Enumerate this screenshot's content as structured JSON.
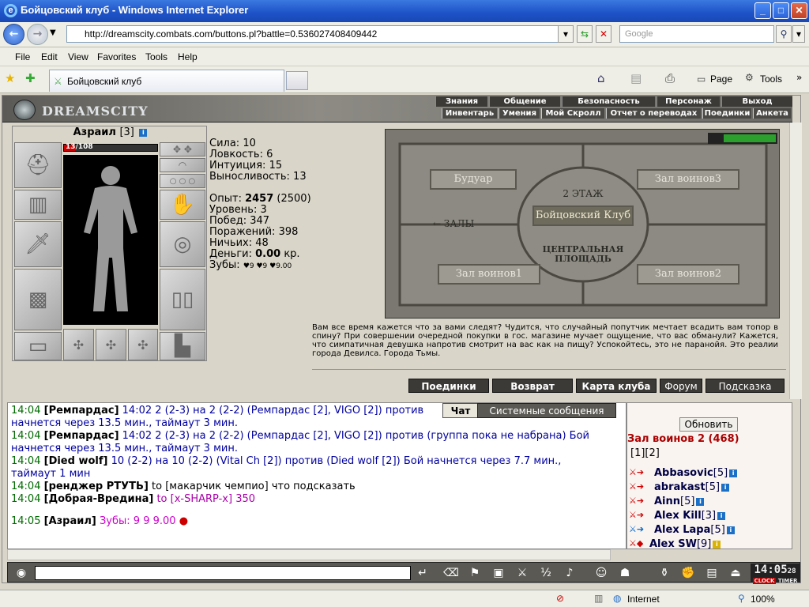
{
  "window": {
    "title": "Бойцовский клуб - Windows Internet Explorer",
    "min": "_",
    "max": "□",
    "close": "✕"
  },
  "address": {
    "url": "http://dreamscity.combats.com/buttons.pl?battle=0.536027408409442",
    "search_placeholder": "Google"
  },
  "menu": [
    "File",
    "Edit",
    "View",
    "Favorites",
    "Tools",
    "Help"
  ],
  "tab": {
    "label": "Бойцовский клуб"
  },
  "toolbar": {
    "page": "Page",
    "tools": "Tools"
  },
  "game": {
    "logo": "DREAMSCITY",
    "topnav": [
      "Знания",
      "Общение",
      "Безопасность",
      "Персонаж",
      "Выход"
    ],
    "subnav": [
      "Инвентарь",
      "Умения",
      "Мой Скролл",
      "Отчет о переводах",
      "Поединки",
      "Анкета"
    ]
  },
  "character": {
    "name": "Азраил",
    "level": "[3]",
    "hp": {
      "current": 13,
      "max": 108,
      "text_cur": "13",
      "text_max": "/108"
    },
    "stats": {
      "strength": "Сила: 10",
      "agility": "Ловкость: 6",
      "intuition": "Интуиция: 15",
      "endurance": "Выносливость: 13",
      "exp_label": "Опыт: ",
      "exp_value": "2457",
      "exp_next": " (2500)",
      "level": "Уровень: 3",
      "wins": "Побед: 347",
      "losses": "Поражений: 398",
      "draws": "Ничьих: 48",
      "money_label": "Деньги: ",
      "money_value": "0.00",
      "money_unit": " кр.",
      "teeth_label": "Зубы: ",
      "teeth_value": "♥9 ♥9 ♥9.00"
    }
  },
  "map": {
    "floor": "2 ЭТАЖ",
    "center": "Бойцовский Клуб",
    "halls_label": "← ЗАЛЫ",
    "square": "ЦЕНТРАЛЬНАЯ ПЛОЩАДЬ",
    "buttons": [
      "Будуар",
      "Зал воинов3",
      "Зал воинов1",
      "Зал воинов2"
    ]
  },
  "lore": "Вам все время кажется что за вами следят? Чудится, что случайный попутчик мечтает всадить вам топор в спину? При совершении очередной покупки в гос. магазине мучает ощущение, что вас обманули? Кажется, что симпатичная девушка напротив смотрит на вас как на пищу? Успокойтесь, это не паранойя. Это реалии города Девилса. Города Тьмы.",
  "bottom_buttons": [
    "Поединки",
    "Возврат",
    "Карта клуба",
    "Форум",
    "Подсказка"
  ],
  "chat": {
    "tabs": [
      "Чат",
      "Системные сообщения"
    ],
    "lines": [
      {
        "time": "14:04",
        "name": "Ремпардас",
        "text": " 14:02 2 (2-3) на 2 (2-2) (Ремпардас [2], VIGO [2]) против"
      },
      {
        "time": "",
        "name": "",
        "text": "начнется через 13.5 мин., таймаут 3 мин."
      },
      {
        "time": "14:04",
        "name": "Ремпардас",
        "text": " 14:02 2 (2-3) на 2 (2-2) (Ремпардас [2], VIGO [2]) против (группа пока не набрана) Бой"
      },
      {
        "time": "",
        "name": "",
        "text": "начнется через 13.5 мин., таймаут 3 мин."
      },
      {
        "time": "14:04",
        "name": "Died wolf",
        "text": " 10 (2-2) на 10 (2-2) (Vital Ch [2]) против (Died wolf [2]) Бой начнется через 7.7 мин.,"
      },
      {
        "time": "",
        "name": "",
        "text": "таймаут 1 мин"
      },
      {
        "time": "14:04",
        "name": "ренджер РТУТЬ",
        "text": " to [макарчик чемпио] что подсказать"
      },
      {
        "time": "14:04",
        "name": "Добрая-Вредина",
        "text": " to [x-SHARP-x] 350"
      },
      {
        "time": "14:05",
        "name": "Азраил",
        "text": " Зубы: 9 9 9.00"
      }
    ]
  },
  "users": {
    "refresh": "Обновить",
    "room": "Зал воинов 2 (468)",
    "pages": "[1][2]",
    "list": [
      {
        "name": "Abbasovic",
        "level": "[5]"
      },
      {
        "name": "abrakast",
        "level": "[5]"
      },
      {
        "name": "Ainn",
        "level": "[5]"
      },
      {
        "name": "Alex Kill",
        "level": "[3]"
      },
      {
        "name": "Alex Lapa",
        "level": "[5]"
      },
      {
        "name": "Alex SW",
        "level": "[9]"
      }
    ]
  },
  "clock": {
    "time": "14:05",
    "sec": "28",
    "clock": "CLOCK",
    "timer": "TIMER"
  },
  "status": {
    "zone": "Internet",
    "zoom": "100%"
  }
}
